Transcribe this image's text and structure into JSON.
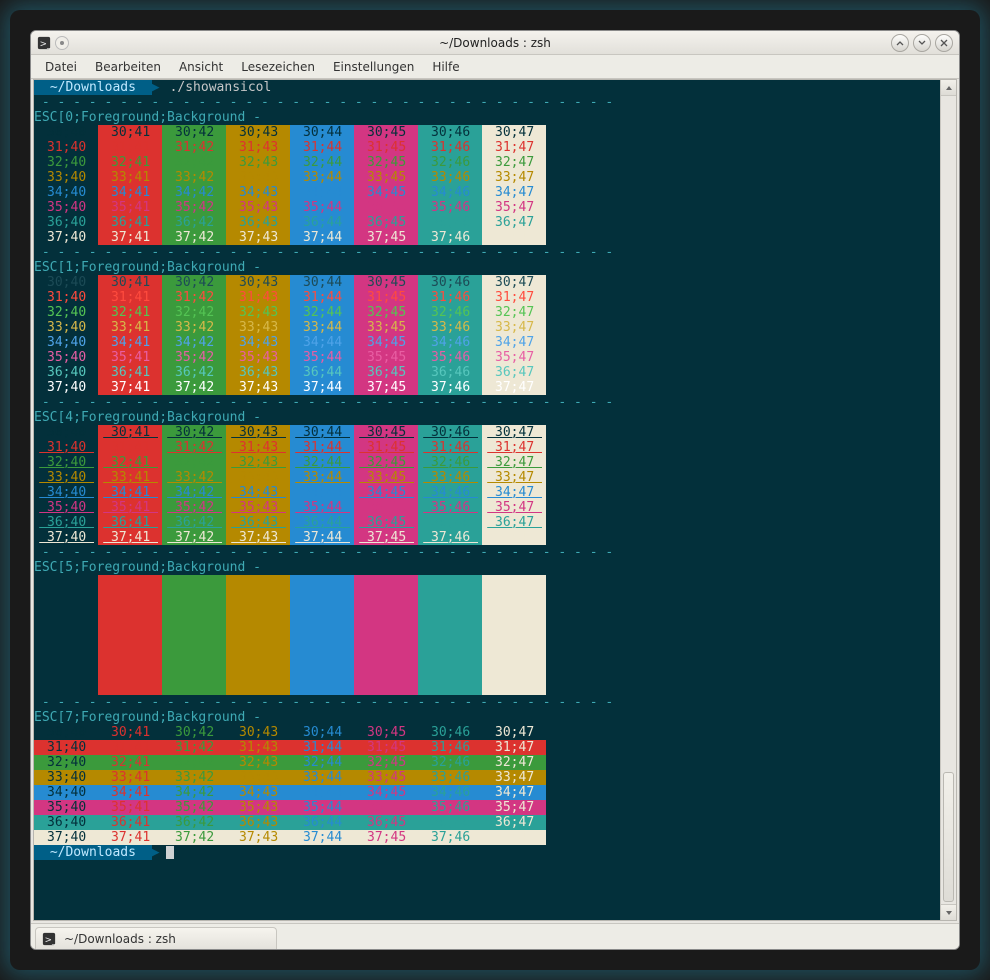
{
  "window": {
    "title": "~/Downloads : zsh"
  },
  "menu": {
    "items": [
      "Datei",
      "Bearbeiten",
      "Ansicht",
      "Lesezeichen",
      "Einstellungen",
      "Hilfe"
    ]
  },
  "tab": {
    "label": "~/Downloads : zsh"
  },
  "prompt": {
    "path": "~/Downloads",
    "command": "./showansicol"
  },
  "divider": " - - - - - - - - - - - - - - - - - - - - - - - - - - - - - - - - - - - - -",
  "ansi": {
    "fg_codes": [
      30,
      31,
      32,
      33,
      34,
      35,
      36,
      37
    ],
    "bg_codes": [
      40,
      41,
      42,
      43,
      44,
      45,
      46,
      47
    ],
    "fg_colors": {
      "30": "#03303b",
      "31": "#dc322f",
      "32": "#3b9a3c",
      "33": "#b58900",
      "34": "#268bd2",
      "35": "#d33682",
      "36": "#2aa198",
      "37": "#eee8d5"
    },
    "fg_bold_colors": {
      "30": "#1c4b56",
      "31": "#ff4b3e",
      "32": "#54c454",
      "33": "#d7b84a",
      "34": "#4fa3e8",
      "35": "#e85fa3",
      "36": "#57c7bd",
      "37": "#ffffff"
    },
    "bg_colors": {
      "40": "#03303b",
      "41": "#dc322f",
      "42": "#3b9a3c",
      "43": "#b58900",
      "44": "#268bd2",
      "45": "#d33682",
      "46": "#2aa198",
      "47": "#eee8d5"
    },
    "blocks": [
      {
        "code": "0",
        "label": "ESC[0;Foreground;Background -",
        "mode": "normal"
      },
      {
        "code": "1",
        "label": "ESC[1;Foreground;Background -",
        "mode": "bold"
      },
      {
        "code": "4",
        "label": "ESC[4;Foreground;Background -",
        "mode": "underline"
      },
      {
        "code": "5",
        "label": "ESC[5;Foreground;Background -",
        "mode": "blink"
      },
      {
        "code": "7",
        "label": "ESC[7;Foreground;Background -",
        "mode": "reverse"
      }
    ]
  }
}
